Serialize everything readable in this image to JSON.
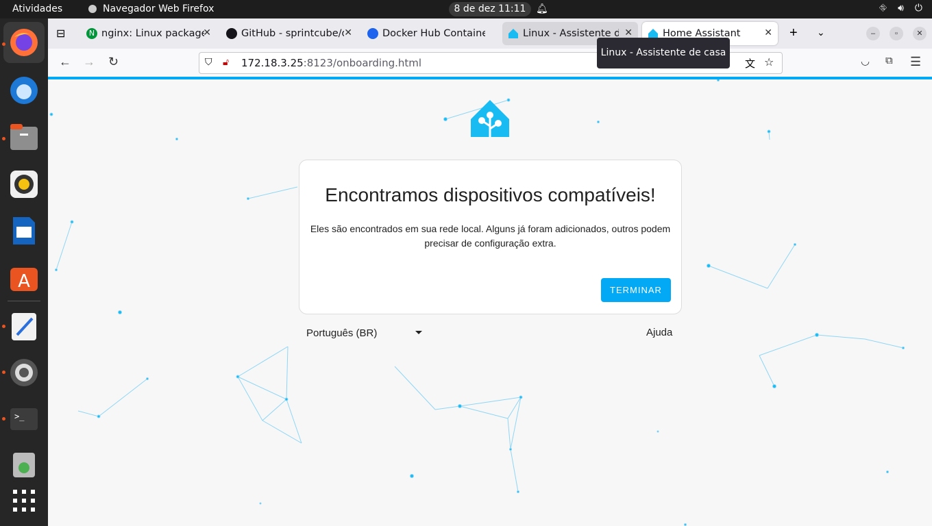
{
  "topbar": {
    "activities": "Atividades",
    "app_name": "Navegador Web Firefox",
    "clock": "8 de dez  11:11"
  },
  "dock": {
    "items": [
      "firefox-icon",
      "thunderbird-icon",
      "files-icon",
      "rhythmbox-icon",
      "libreoffice-impress-icon",
      "app-center-icon",
      "text-editor-icon",
      "settings-icon",
      "terminal-icon",
      "trash-icon",
      "show-apps-icon"
    ]
  },
  "tabs": [
    {
      "label": "nginx: Linux packages"
    },
    {
      "label": "GitHub - sprintcube/do"
    },
    {
      "label": "Docker Hub Container"
    },
    {
      "label": "Linux - Assistente de c"
    },
    {
      "label": "Home Assistant"
    }
  ],
  "url": {
    "host": "172.18.3.25",
    "path": ":8123/onboarding.html"
  },
  "tooltip": "Linux - Assistente de casa",
  "card": {
    "title": "Encontramos dispositivos compatíveis!",
    "body": "Eles são encontrados em sua rede local. Alguns já foram adicionados, outros podem precisar de configuração extra.",
    "finish": "TERMINAR"
  },
  "language": "Português (BR)",
  "help": "Ajuda",
  "colors": {
    "accent": "#03a9f4",
    "ha_blue": "#18bcf2"
  }
}
